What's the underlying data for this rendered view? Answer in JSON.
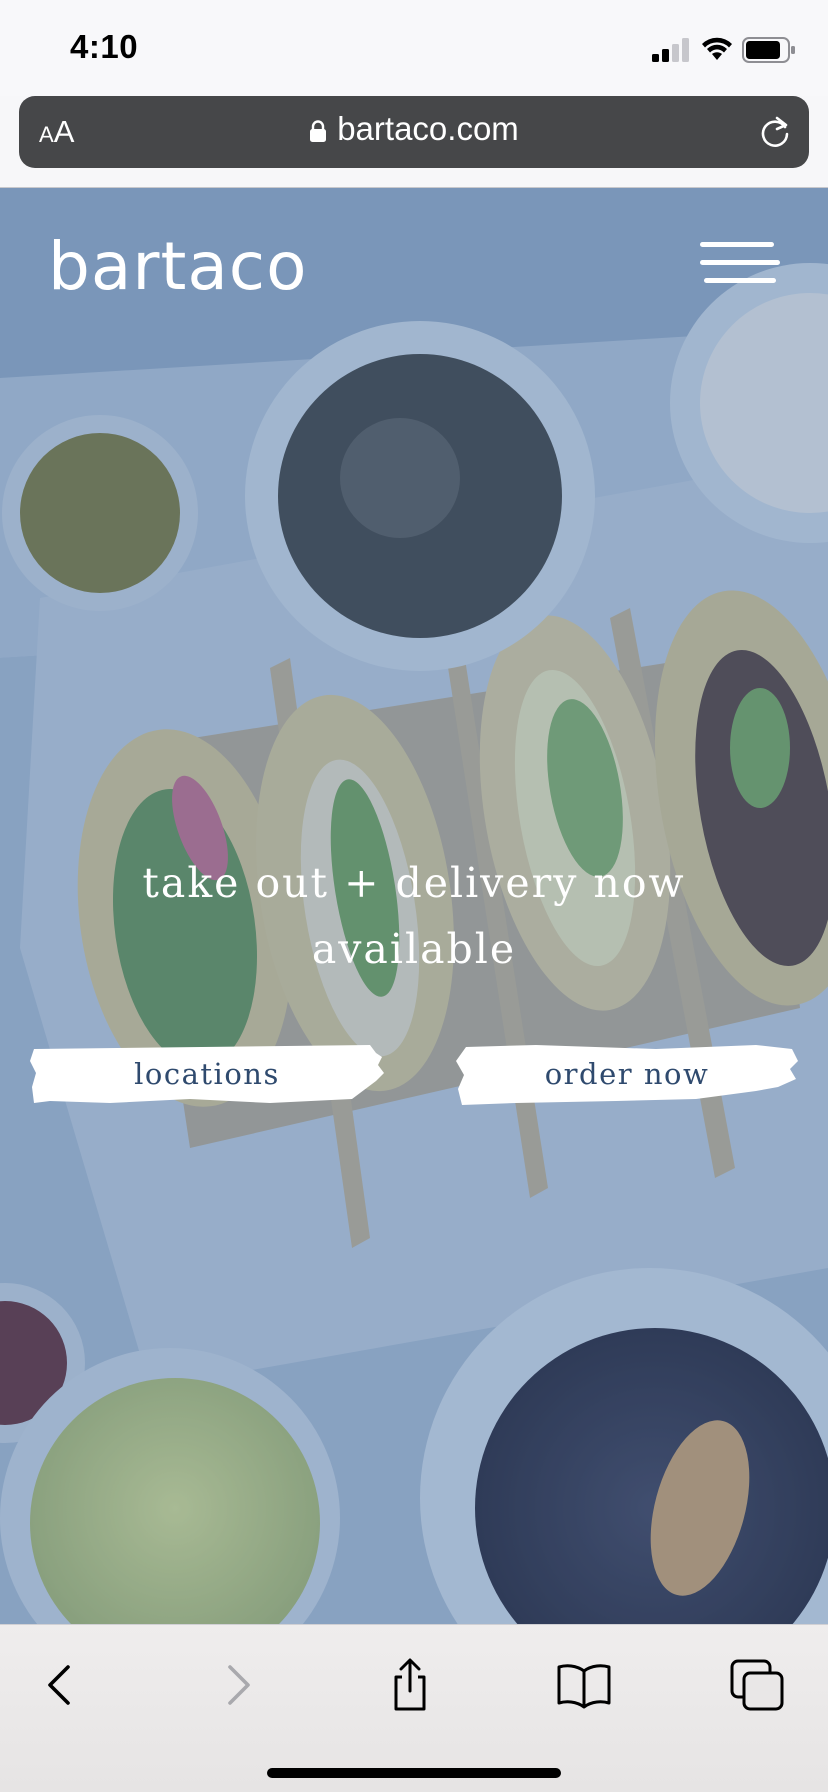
{
  "status_bar": {
    "time": "4:10",
    "icons": [
      "cellular-signal-icon",
      "wifi-icon",
      "battery-icon"
    ]
  },
  "browser": {
    "text_size_label_small": "A",
    "text_size_label_big": "A",
    "url": "bartaco.com",
    "icons": [
      "lock-icon",
      "reload-icon"
    ]
  },
  "site": {
    "logo": "bartaco",
    "menu_icon": "hamburger-menu-icon",
    "headline": "take out + delivery now available",
    "buttons": {
      "locations": "locations",
      "order_now": "order now"
    }
  },
  "toolbar": {
    "items": [
      "back-icon",
      "forward-icon",
      "share-icon",
      "bookmarks-icon",
      "tabs-icon"
    ],
    "forward_enabled": false
  },
  "colors": {
    "hero_tint": "#6f8fb1",
    "cta_text": "#2f4a6e",
    "url_bar": "#464749"
  }
}
